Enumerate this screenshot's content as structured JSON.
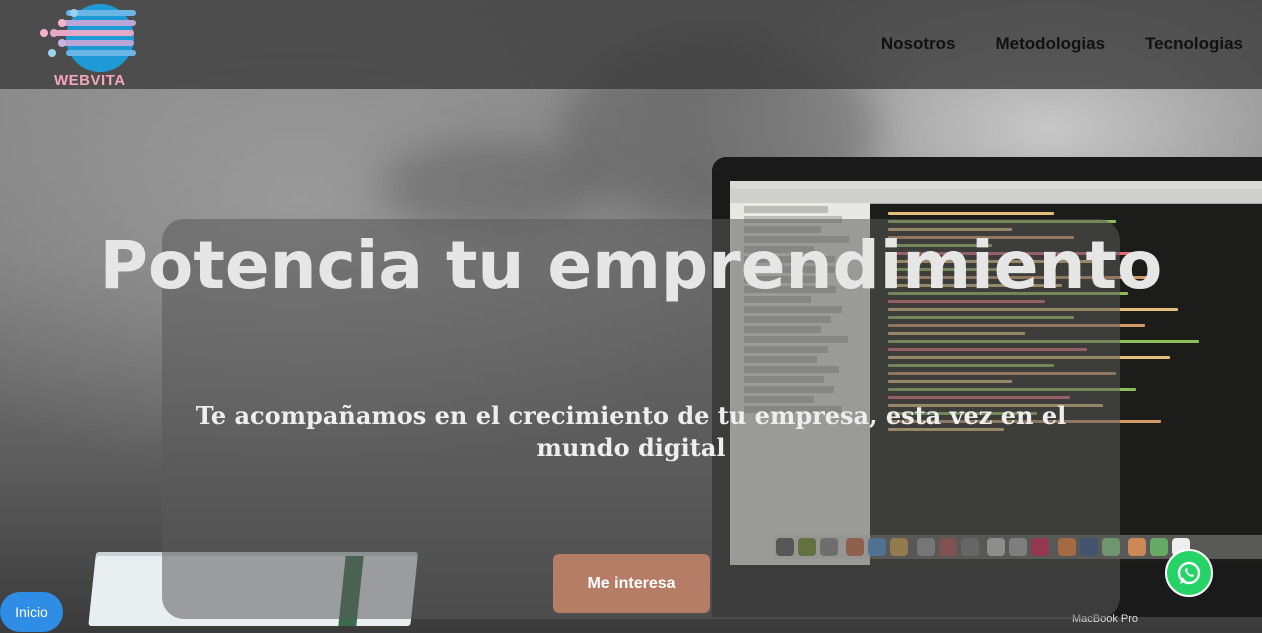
{
  "brand": {
    "name": "WEBVITA",
    "accent_pink": "#f5a6b8",
    "accent_blue": "#1e9bd7"
  },
  "nav": {
    "items": [
      {
        "label": "Nosotros"
      },
      {
        "label": "Metodologias"
      },
      {
        "label": "Tecnologias"
      }
    ]
  },
  "hero": {
    "title": "Potencia tu emprendimiento",
    "subtitle": "Te acompañamos en el crecimiento de tu empresa, esta vez en el mundo digital",
    "cta_label": "Me interesa",
    "cta_color": "#b57c66"
  },
  "floating": {
    "inicio_label": "Inicio",
    "whatsapp_icon": "whatsapp-icon",
    "inicio_color": "#2f8de6"
  },
  "background": {
    "laptop_label": "MacBook Pro"
  }
}
